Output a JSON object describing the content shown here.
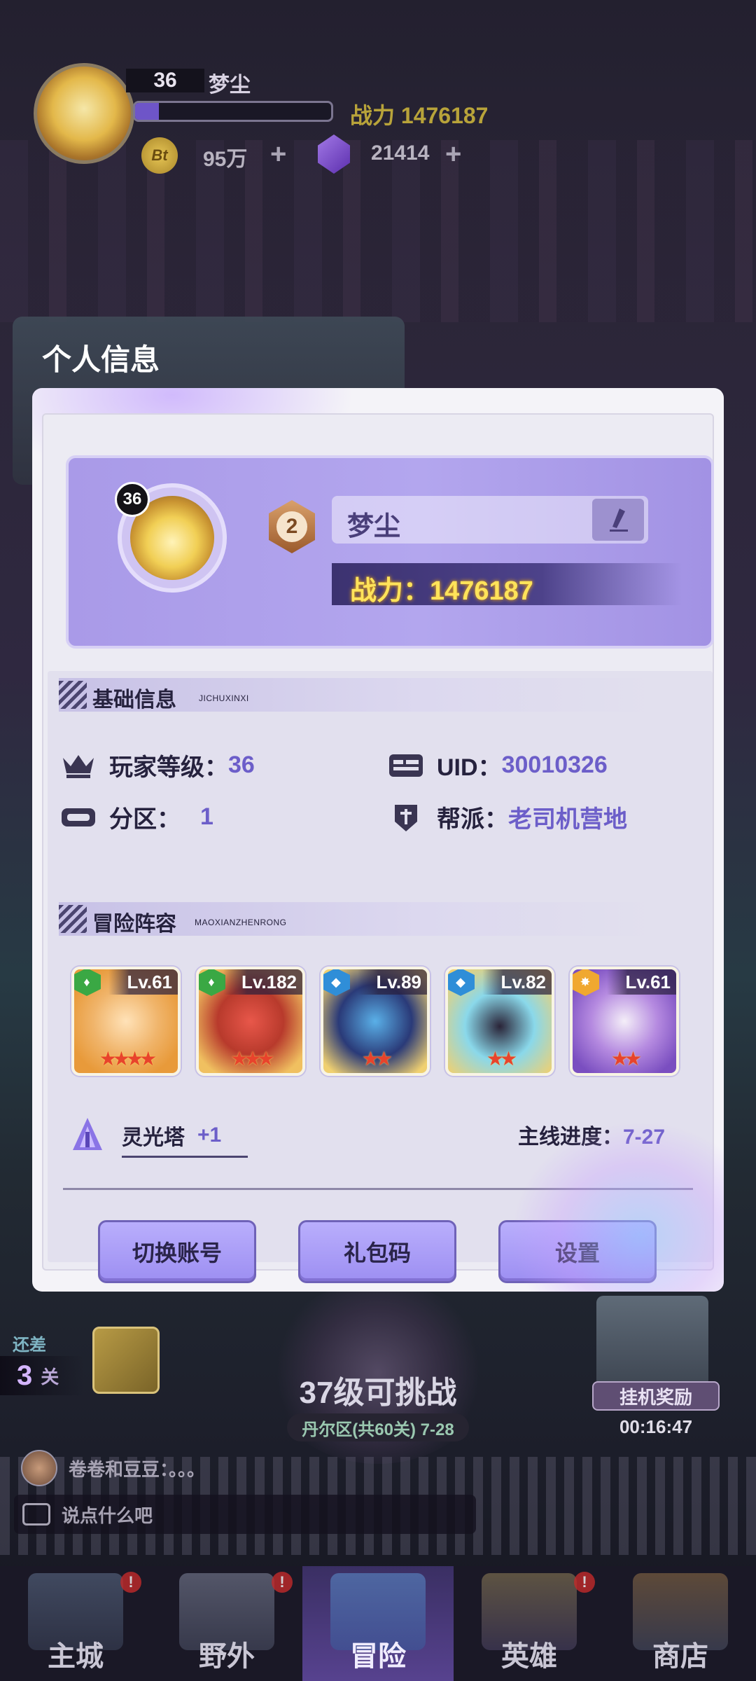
{
  "hud": {
    "level": "36",
    "name": "梦尘",
    "power": "战力 1476187",
    "exp_fraction": 0.12,
    "coin_icon_text": "Bt",
    "coins": "95万",
    "gems": "21414",
    "plus": "+"
  },
  "dialog": {
    "title": "个人信息",
    "profile": {
      "level_badge": "36",
      "rank": "2",
      "name": "梦尘",
      "power": "战力：1476187"
    },
    "basic_section": {
      "title": "基础信息",
      "subtitle": "JICHUXINXI",
      "player_level_label": "玩家等级：",
      "player_level": "36",
      "uid_label": "UID：",
      "uid": "30010326",
      "zone_label": "分区：",
      "zone": "1",
      "guild_label": "帮派：",
      "guild": "老司机营地"
    },
    "lineup_section": {
      "title": "冒险阵容",
      "subtitle": "MAOXIANZHENRONG",
      "heroes": [
        {
          "level": "Lv.61",
          "stars": "★★★★",
          "element": "nature",
          "element_color": "#3aa844"
        },
        {
          "level": "Lv.182",
          "stars": "★★★",
          "element": "nature",
          "element_color": "#3aa844"
        },
        {
          "level": "Lv.89",
          "stars": "★★",
          "element": "water",
          "element_color": "#2f8ed8"
        },
        {
          "level": "Lv.82",
          "stars": "★★",
          "element": "water",
          "element_color": "#2f8ed8"
        },
        {
          "level": "Lv.61",
          "stars": "★★",
          "element": "light",
          "element_color": "#f0a830"
        }
      ],
      "tower_label": "灵光塔",
      "tower_value": "+1",
      "progress_label": "主线进度：",
      "progress_value": "7-27"
    },
    "buttons": {
      "switch_account": "切换账号",
      "gift_code": "礼包码",
      "settings": "设置"
    }
  },
  "stage": {
    "remaining_label": "还差",
    "remaining_count": "3",
    "remaining_unit": "关",
    "challenge_text": "37级可挑战",
    "zone_info": "丹尔区(共60关) 7-28",
    "afk_reward": "挂机奖励",
    "afk_timer": "00:16:47"
  },
  "chat": {
    "line": "卷卷和豆豆：。。。",
    "placeholder": "说点什么吧"
  },
  "nav": {
    "items": [
      {
        "label": "主城",
        "badge": "!"
      },
      {
        "label": "野外",
        "badge": "!"
      },
      {
        "label": "冒险",
        "badge": ""
      },
      {
        "label": "英雄",
        "badge": "!"
      },
      {
        "label": "商店",
        "badge": ""
      }
    ]
  }
}
